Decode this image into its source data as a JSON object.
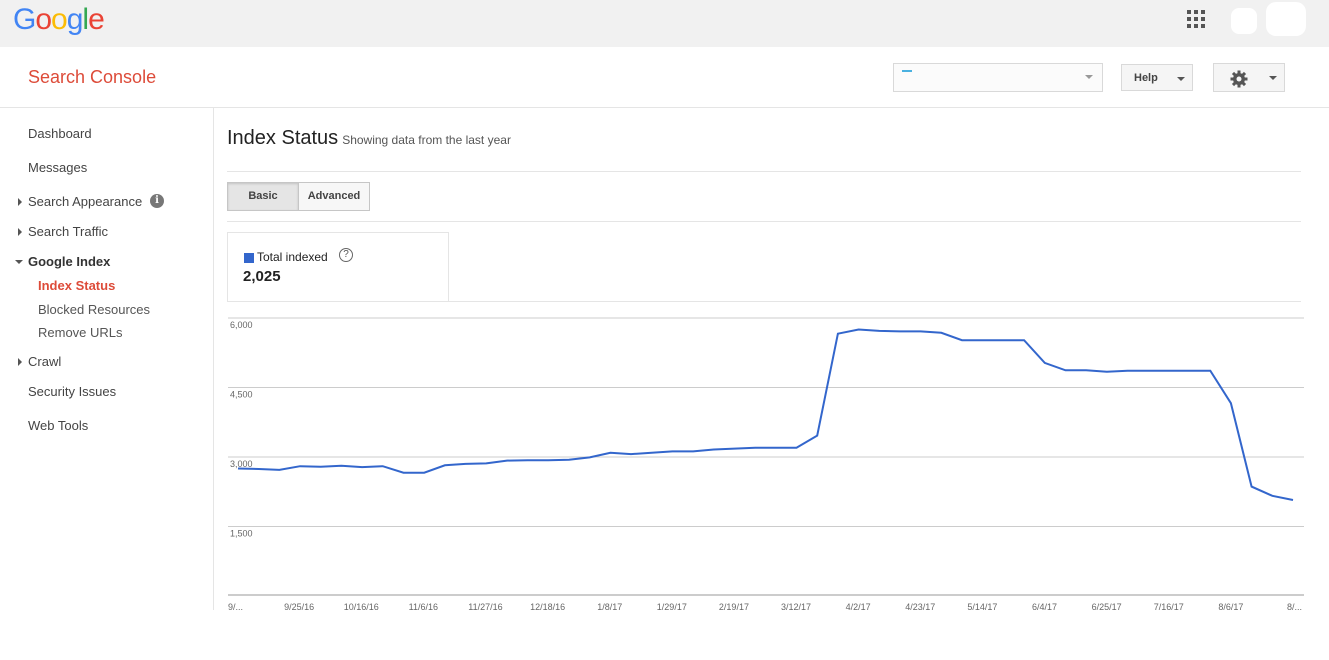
{
  "header": {
    "logo_letters": [
      {
        "ch": "G",
        "color": "#4285f4"
      },
      {
        "ch": "o",
        "color": "#ea4335"
      },
      {
        "ch": "o",
        "color": "#fbbc05"
      },
      {
        "ch": "g",
        "color": "#4285f4"
      },
      {
        "ch": "l",
        "color": "#34a853"
      },
      {
        "ch": "e",
        "color": "#ea4335"
      }
    ],
    "app_title": "Search Console",
    "help_label": "Help"
  },
  "sidebar": {
    "dashboard": "Dashboard",
    "messages": "Messages",
    "search_appearance": "Search Appearance",
    "search_traffic": "Search Traffic",
    "google_index": "Google Index",
    "index_status": "Index Status",
    "blocked_resources": "Blocked Resources",
    "remove_urls": "Remove URLs",
    "crawl": "Crawl",
    "security_issues": "Security Issues",
    "web_tools": "Web Tools",
    "info_glyph": "i"
  },
  "main": {
    "title": "Index Status",
    "subtitle": "Showing data from the last year",
    "tabs": [
      "Basic",
      "Advanced"
    ],
    "legend_label": "Total indexed",
    "legend_help": "?",
    "legend_value": "2,025"
  },
  "colors": {
    "accent": "#dd4b39",
    "series": "#3366cc"
  },
  "chart_data": {
    "type": "line",
    "series": [
      {
        "name": "Total indexed",
        "values": [
          2730,
          2720,
          2700,
          2780,
          2770,
          2790,
          2760,
          2780,
          2640,
          2640,
          2800,
          2830,
          2840,
          2900,
          2910,
          2910,
          2920,
          2970,
          3070,
          3040,
          3070,
          3100,
          3100,
          3140,
          3160,
          3180,
          3180,
          3180,
          3440,
          5640,
          5730,
          5700,
          5690,
          5690,
          5660,
          5500,
          5500,
          5500,
          5500,
          5010,
          4850,
          4850,
          4820,
          4840,
          4840,
          4840,
          4840,
          4840,
          4140,
          2340,
          2140,
          2050
        ]
      }
    ],
    "x_ticks": [
      "9/...",
      "9/25/16",
      "10/16/16",
      "11/6/16",
      "11/27/16",
      "12/18/16",
      "1/8/17",
      "1/29/17",
      "2/19/17",
      "3/12/17",
      "4/2/17",
      "4/23/17",
      "5/14/17",
      "6/4/17",
      "6/25/17",
      "7/16/17",
      "8/6/17",
      "8/..."
    ],
    "y_ticks": [
      "6,000",
      "4,500",
      "3,000",
      "1,500"
    ],
    "ylim": [
      0,
      6000
    ],
    "grid": true
  }
}
